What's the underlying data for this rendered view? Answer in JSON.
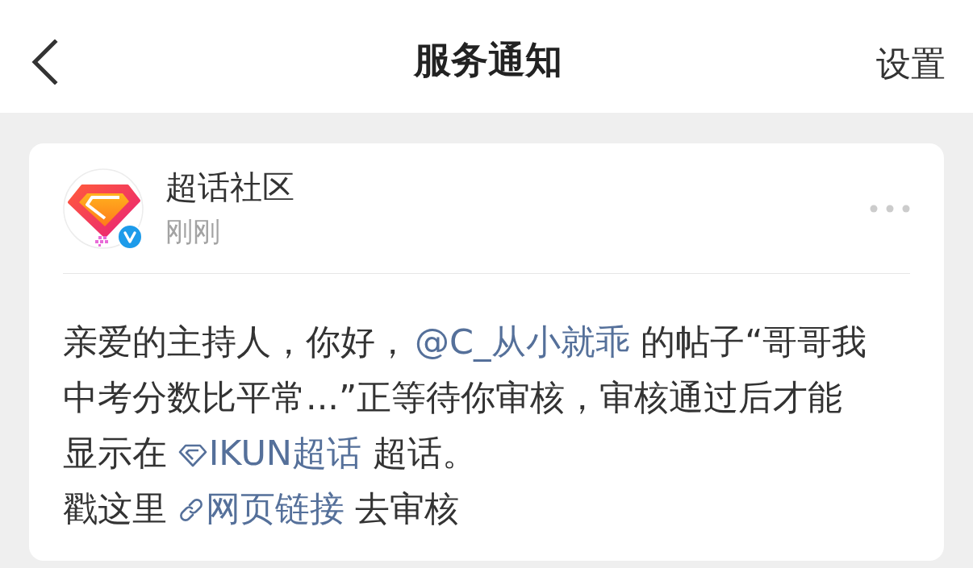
{
  "header": {
    "title": "服务通知",
    "action": "设置"
  },
  "notification": {
    "sender": "超话社区",
    "time": "刚刚",
    "verified": true,
    "message": [
      {
        "kind": "text",
        "text": "亲爱的主持人，你好，"
      },
      {
        "kind": "mention",
        "text": "@C_从小就乖"
      },
      {
        "kind": "text",
        "text": " 的帖子“哥哥我中考分数比平常...”正等待你审核，审核通过后才能显示在 "
      },
      {
        "kind": "topic",
        "text": "IKUN超话"
      },
      {
        "kind": "text",
        "text": " 超话。"
      }
    ],
    "action_line": [
      {
        "kind": "text",
        "text": "戳这里 "
      },
      {
        "kind": "weblink",
        "text": "网页链接"
      },
      {
        "kind": "text",
        "text": " 去审核"
      }
    ]
  }
}
